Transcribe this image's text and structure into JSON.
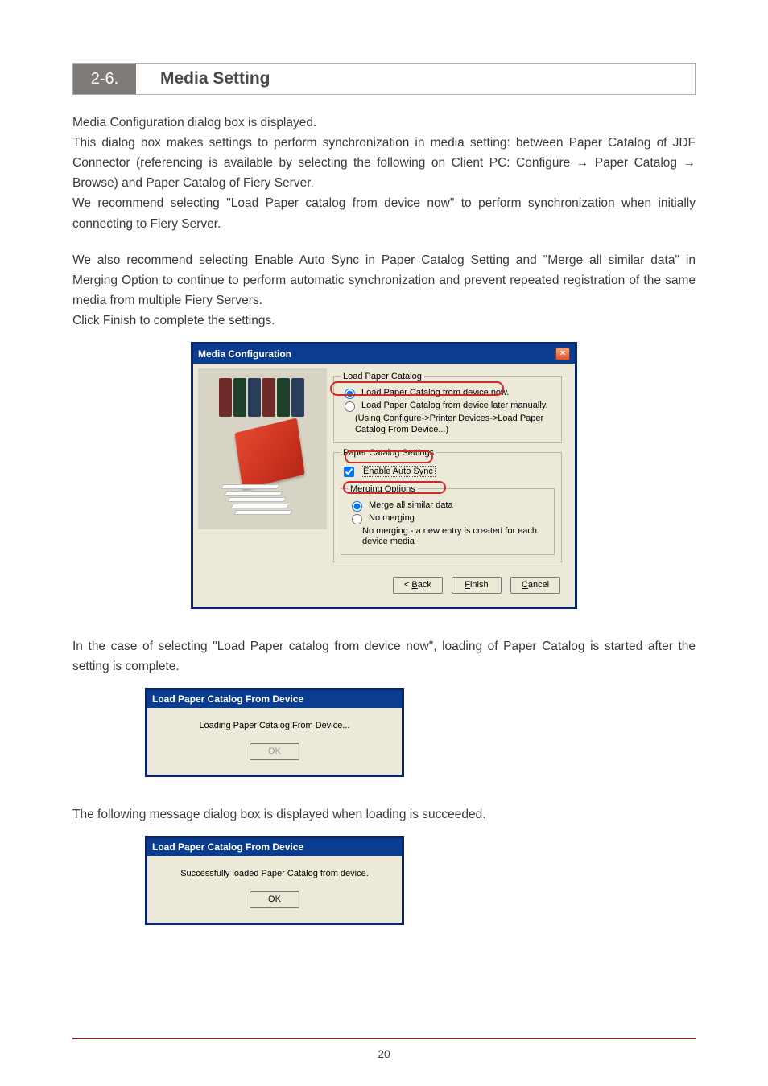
{
  "section": {
    "number": "2-6.",
    "title": "Media Setting"
  },
  "para1": "Media Configuration dialog box is displayed.",
  "para2a": "This dialog box makes settings to perform synchronization in media setting: between Paper Catalog of JDF Connector (referencing is available by selecting the following on Client PC: Configure ",
  "arrow": "→",
  "para2b": " Paper Catalog ",
  "para2c": " Browse) and Paper Catalog of Fiery Server.",
  "para3": "We recommend selecting \"Load Paper catalog from device now\" to perform synchronization when initially connecting to Fiery Server.",
  "para4": "We also recommend selecting Enable Auto Sync in Paper Catalog Setting and \"Merge all similar data\" in Merging Option to continue to perform automatic synchronization and prevent repeated registration of the same media from multiple Fiery Servers.",
  "para5": "Click Finish to complete the settings.",
  "dlg1": {
    "title": "Media Configuration",
    "grp1_legend": "Load Paper Catalog",
    "opt1": "Load Paper Catalog from device now.",
    "opt2": "Load Paper Catalog from device later manually.",
    "opt2_sub": "(Using Configure->Printer Devices->Load Paper Catalog From Device...)",
    "grp2_legend": "Paper Catalog Settings",
    "chk1_pre": "Enable ",
    "chk1_mn": "A",
    "chk1_post": "uto Sync",
    "grp3_legend": "Merging Options",
    "opt3": "Merge all similar data",
    "opt4": "No merging",
    "opt4_sub": "No merging - a new entry is created for each device media",
    "btn_back_pre": "< ",
    "btn_back_mn": "B",
    "btn_back_post": "ack",
    "btn_finish_mn": "F",
    "btn_finish_post": "inish",
    "btn_cancel_mn": "C",
    "btn_cancel_post": "ancel"
  },
  "para6": "In the case of selecting \"Load Paper catalog from device now\", loading of Paper Catalog is started after the setting is complete.",
  "dlg2": {
    "title": "Load Paper Catalog From Device",
    "msg": "Loading Paper Catalog From Device...",
    "ok": "OK"
  },
  "para7": "The following message dialog box is displayed when loading is succeeded.",
  "dlg3": {
    "title": "Load Paper Catalog From Device",
    "msg": "Successfully loaded Paper Catalog from device.",
    "ok": "OK"
  },
  "pagenum": "20"
}
